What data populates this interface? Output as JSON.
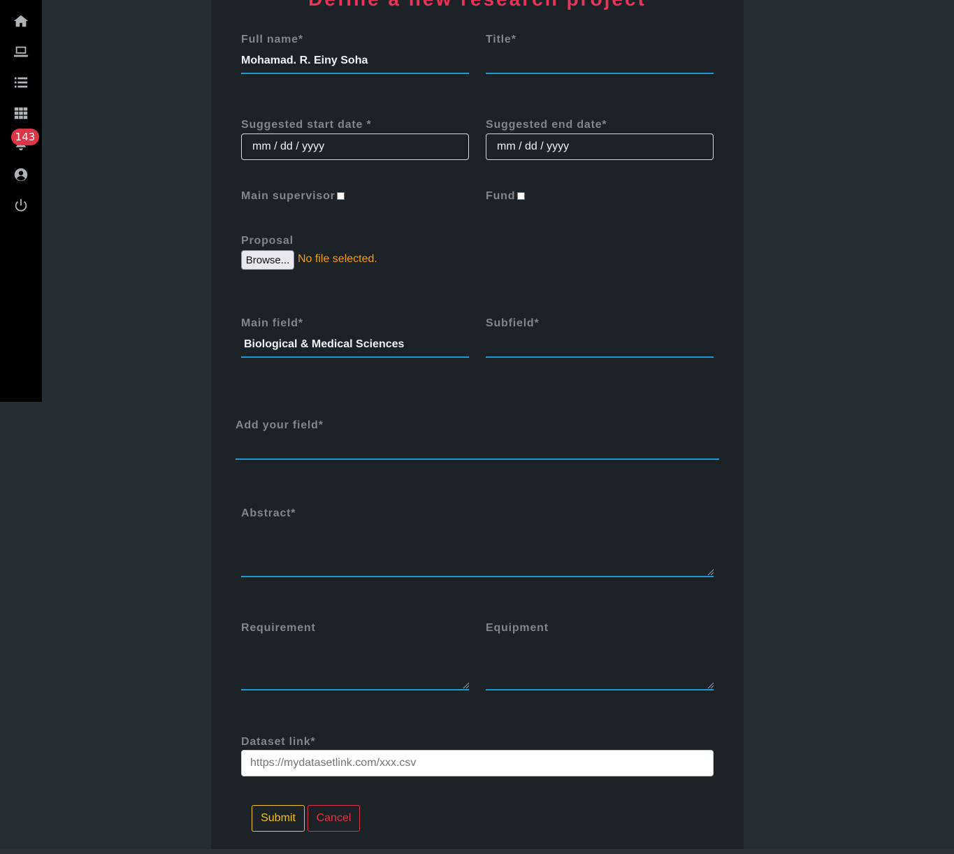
{
  "sidebar": {
    "icons": [
      "home-icon",
      "laptop-icon",
      "list-icon",
      "grid-icon",
      "bell-icon",
      "user-circle-icon",
      "power-icon"
    ],
    "notification_count": "143"
  },
  "form": {
    "title": "Define a new research project",
    "full_name": {
      "label": "Full name*",
      "value": "Mohamad. R. Einy Soha"
    },
    "title_field": {
      "label": "Title*",
      "value": ""
    },
    "start_date": {
      "label": "Suggested start date *",
      "placeholder": "mm / dd / yyyy"
    },
    "end_date": {
      "label": "Suggested end date*",
      "placeholder": "mm / dd / yyyy"
    },
    "main_supervisor": {
      "label": "Main supervisor",
      "checked": false
    },
    "fund": {
      "label": "Fund",
      "checked": false
    },
    "proposal": {
      "label": "Proposal",
      "browse_label": "Browse...",
      "status": "No file selected."
    },
    "main_field": {
      "label": "Main field*",
      "value": "Biological & Medical Sciences"
    },
    "subfield": {
      "label": "Subfield*",
      "value": ""
    },
    "add_field": {
      "label": "Add your field*",
      "value": ""
    },
    "abstract": {
      "label": "Abstract*"
    },
    "requirement": {
      "label": "Requirement"
    },
    "equipment": {
      "label": "Equipment"
    },
    "dataset_link": {
      "label": "Dataset link*",
      "placeholder": "https://mydatasetlink.com/xxx.csv"
    },
    "submit_label": "Submit",
    "cancel_label": "Cancel"
  },
  "colors": {
    "accent_title": "#e8335a",
    "input_underline": "#1b9ad6",
    "submit": "#f0c419",
    "cancel": "#dc3545",
    "badge": "#dc3545",
    "file_status": "#f39c12"
  }
}
